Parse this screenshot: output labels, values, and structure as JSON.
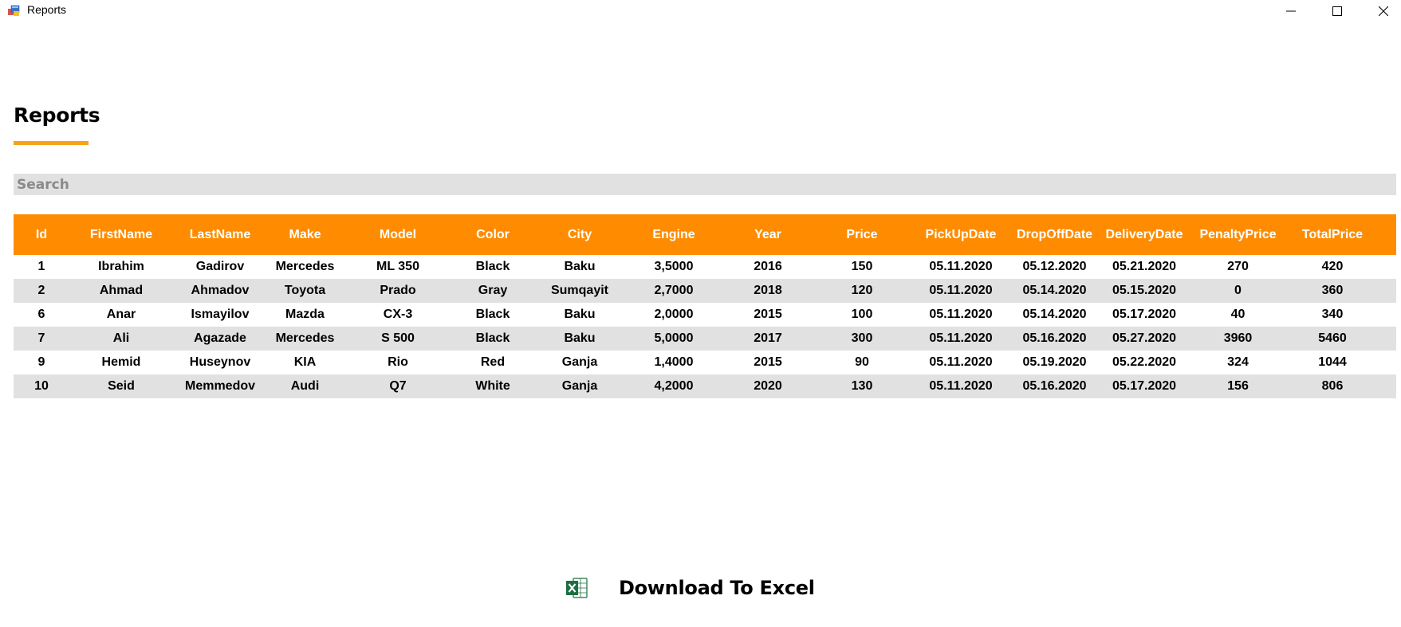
{
  "window": {
    "title": "Reports"
  },
  "page": {
    "title": "Reports"
  },
  "search": {
    "placeholder": "Search",
    "value": ""
  },
  "table": {
    "columns": [
      "Id",
      "FirstName",
      "LastName",
      "Make",
      "Model",
      "Color",
      "City",
      "Engine",
      "Year",
      "Price",
      "PickUpDate",
      "DropOffDate",
      "DeliveryDate",
      "PenaltyPrice",
      "TotalPrice"
    ],
    "rows": [
      [
        "1",
        "Ibrahim",
        "Gadirov",
        "Mercedes",
        "ML 350",
        "Black",
        "Baku",
        "3,5000",
        "2016",
        "150",
        "05.11.2020",
        "05.12.2020",
        "05.21.2020",
        "270",
        "420"
      ],
      [
        "2",
        "Ahmad",
        "Ahmadov",
        "Toyota",
        "Prado",
        "Gray",
        "Sumqayit",
        "2,7000",
        "2018",
        "120",
        "05.11.2020",
        "05.14.2020",
        "05.15.2020",
        "0",
        "360"
      ],
      [
        "6",
        "Anar",
        "Ismayilov",
        "Mazda",
        "CX-3",
        "Black",
        "Baku",
        "2,0000",
        "2015",
        "100",
        "05.11.2020",
        "05.14.2020",
        "05.17.2020",
        "40",
        "340"
      ],
      [
        "7",
        "Ali",
        "Agazade",
        "Mercedes",
        "S 500",
        "Black",
        "Baku",
        "5,0000",
        "2017",
        "300",
        "05.11.2020",
        "05.16.2020",
        "05.27.2020",
        "3960",
        "5460"
      ],
      [
        "9",
        "Hemid",
        "Huseynov",
        "KIA",
        "Rio",
        "Red",
        "Ganja",
        "1,4000",
        "2015",
        "90",
        "05.11.2020",
        "05.19.2020",
        "05.22.2020",
        "324",
        "1044"
      ],
      [
        "10",
        "Seid",
        "Memmedov",
        "Audi",
        "Q7",
        "White",
        "Ganja",
        "4,2000",
        "2020",
        "130",
        "05.11.2020",
        "05.16.2020",
        "05.17.2020",
        "156",
        "806"
      ]
    ]
  },
  "download": {
    "label": "Download To Excel",
    "icon": "excel-icon"
  },
  "colors": {
    "accent": "#ff8c00",
    "underline": "#f7a21b",
    "row_alt": "#e1e1e1",
    "excel_green": "#1d6f42"
  }
}
